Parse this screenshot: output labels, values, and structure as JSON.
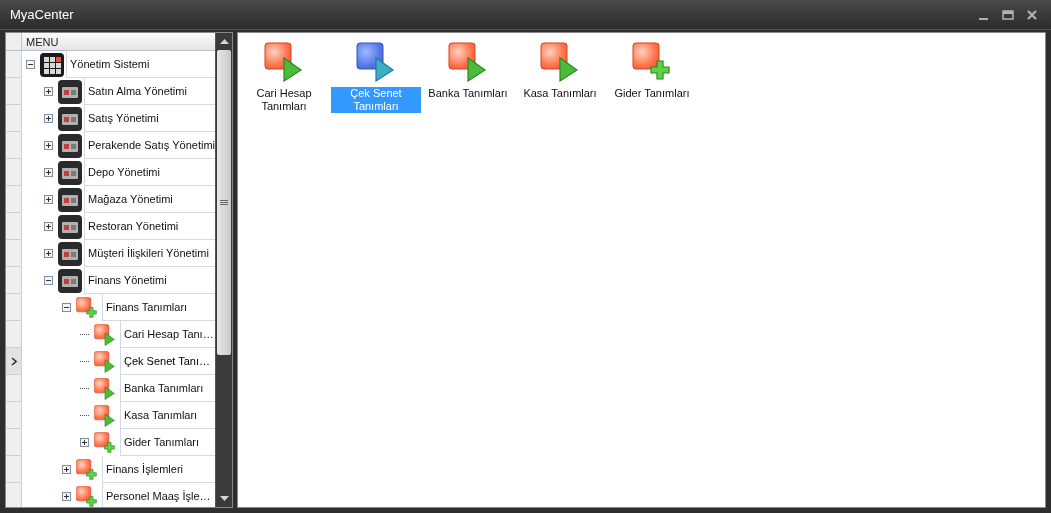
{
  "window": {
    "title": "MyaCenter"
  },
  "tree": {
    "header": "MENU",
    "items": [
      {
        "label": "Yönetim Sistemi",
        "kind": "system",
        "expanded": true,
        "selected": false,
        "children": [
          {
            "label": "Satın Alma Yönetimi",
            "kind": "module",
            "expanded": false,
            "selected": false
          },
          {
            "label": "Satış Yönetimi",
            "kind": "module",
            "expanded": false,
            "selected": false
          },
          {
            "label": "Perakende Satış Yönetimi",
            "kind": "module",
            "expanded": false,
            "selected": false
          },
          {
            "label": "Depo Yönetimi",
            "kind": "module",
            "expanded": false,
            "selected": false
          },
          {
            "label": "Mağaza Yönetimi",
            "kind": "module",
            "expanded": false,
            "selected": false
          },
          {
            "label": "Restoran Yönetimi",
            "kind": "module",
            "expanded": false,
            "selected": false
          },
          {
            "label": "Müşteri İlişkileri Yönetimi",
            "kind": "module",
            "expanded": false,
            "selected": false
          },
          {
            "label": "Finans Yönetimi",
            "kind": "module",
            "expanded": true,
            "selected": false,
            "children": [
              {
                "label": "Finans Tanımları",
                "kind": "group",
                "expanded": true,
                "selected": false,
                "children": [
                  {
                    "label": "Cari Hesap Tanı…",
                    "kind": "form",
                    "selected": false
                  },
                  {
                    "label": "Çek Senet Tanı…",
                    "kind": "form",
                    "selected": true
                  },
                  {
                    "label": "Banka Tanımları",
                    "kind": "form",
                    "selected": false
                  },
                  {
                    "label": "Kasa Tanımları",
                    "kind": "form",
                    "selected": false
                  },
                  {
                    "label": "Gider Tanımları",
                    "kind": "group",
                    "expanded": false,
                    "selected": false
                  }
                ]
              },
              {
                "label": "Finans İşlemleri",
                "kind": "group",
                "expanded": false,
                "selected": false
              },
              {
                "label": "Personel Maaş İşle…",
                "kind": "group",
                "expanded": false,
                "selected": false
              }
            ]
          }
        ]
      }
    ]
  },
  "desktop": {
    "items": [
      {
        "label": "Cari Hesap Tanımları",
        "kind": "form",
        "selected": false
      },
      {
        "label": "Çek Senet Tanımları",
        "kind": "form",
        "selected": true
      },
      {
        "label": "Banka Tanımları",
        "kind": "form",
        "selected": false
      },
      {
        "label": "Kasa Tanımları",
        "kind": "form",
        "selected": false
      },
      {
        "label": "Gider Tanımları",
        "kind": "group",
        "selected": false
      }
    ]
  }
}
